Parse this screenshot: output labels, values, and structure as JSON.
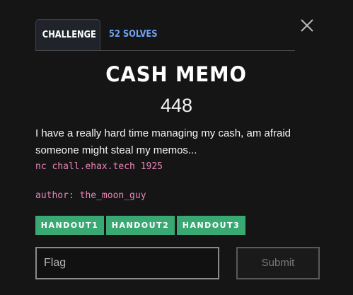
{
  "tabs": {
    "challenge_label": "CHALLENGE",
    "solves_label": "52 SOLVES"
  },
  "challenge": {
    "name": "CASH MEMO",
    "points": "448",
    "description": "I have a really hard time managing my cash, am afraid someone might steal my memos...",
    "connection": "nc chall.ehax.tech 1925",
    "author": "author: the_moon_guy"
  },
  "handouts": [
    {
      "label": "HANDOUT1"
    },
    {
      "label": "HANDOUT2"
    },
    {
      "label": "HANDOUT3"
    }
  ],
  "form": {
    "flag_placeholder": "Flag",
    "submit_label": "Submit"
  },
  "icons": {
    "close": "close-icon"
  },
  "colors": {
    "modal_background": "#151515",
    "handout_button": "#39a873",
    "solves_tab_text": "#6fa3f2",
    "code_text": "#e685b5"
  }
}
